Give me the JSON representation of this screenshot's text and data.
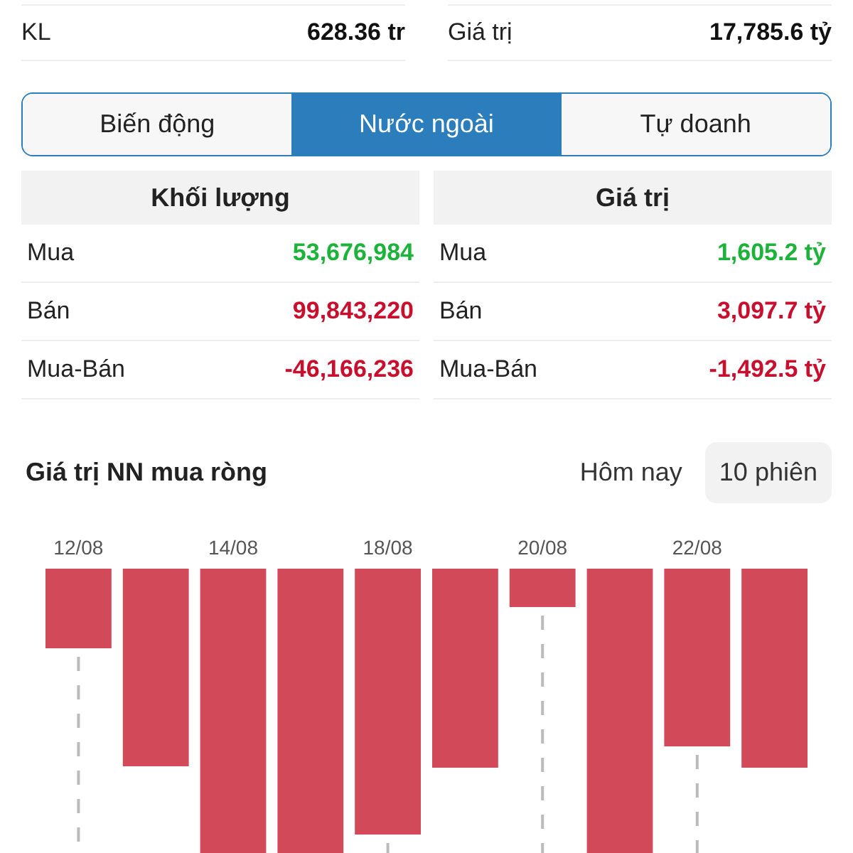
{
  "summary": [
    {
      "label": "KL",
      "value": "628.36 tr"
    },
    {
      "label": "Giá trị",
      "value": "17,785.6 tỷ"
    }
  ],
  "tabs": [
    {
      "label": "Biến động",
      "selected": false
    },
    {
      "label": "Nước ngoài",
      "selected": true
    },
    {
      "label": "Tự doanh",
      "selected": false
    }
  ],
  "tables": [
    {
      "title": "Khối lượng",
      "rows": [
        {
          "label": "Mua",
          "value": "53,676,984",
          "color": "#1db33a"
        },
        {
          "label": "Bán",
          "value": "99,843,220",
          "color": "#c8102e"
        },
        {
          "label": "Mua-Bán",
          "value": "-46,166,236",
          "color": "#c8102e"
        }
      ]
    },
    {
      "title": "Giá trị",
      "rows": [
        {
          "label": "Mua",
          "value": "1,605.2 tỷ",
          "color": "#1db33a"
        },
        {
          "label": "Bán",
          "value": "3,097.7 tỷ",
          "color": "#c8102e"
        },
        {
          "label": "Mua-Bán",
          "value": "-1,492.5 tỷ",
          "color": "#c8102e"
        }
      ]
    }
  ],
  "chart": {
    "title": "Giá trị NN mua ròng",
    "periods": [
      {
        "label": "Hôm nay",
        "selected": false
      },
      {
        "label": "10 phiên",
        "selected": true
      }
    ],
    "date_labels": [
      "12/08",
      "14/08",
      "18/08",
      "20/08",
      "22/08"
    ]
  }
}
